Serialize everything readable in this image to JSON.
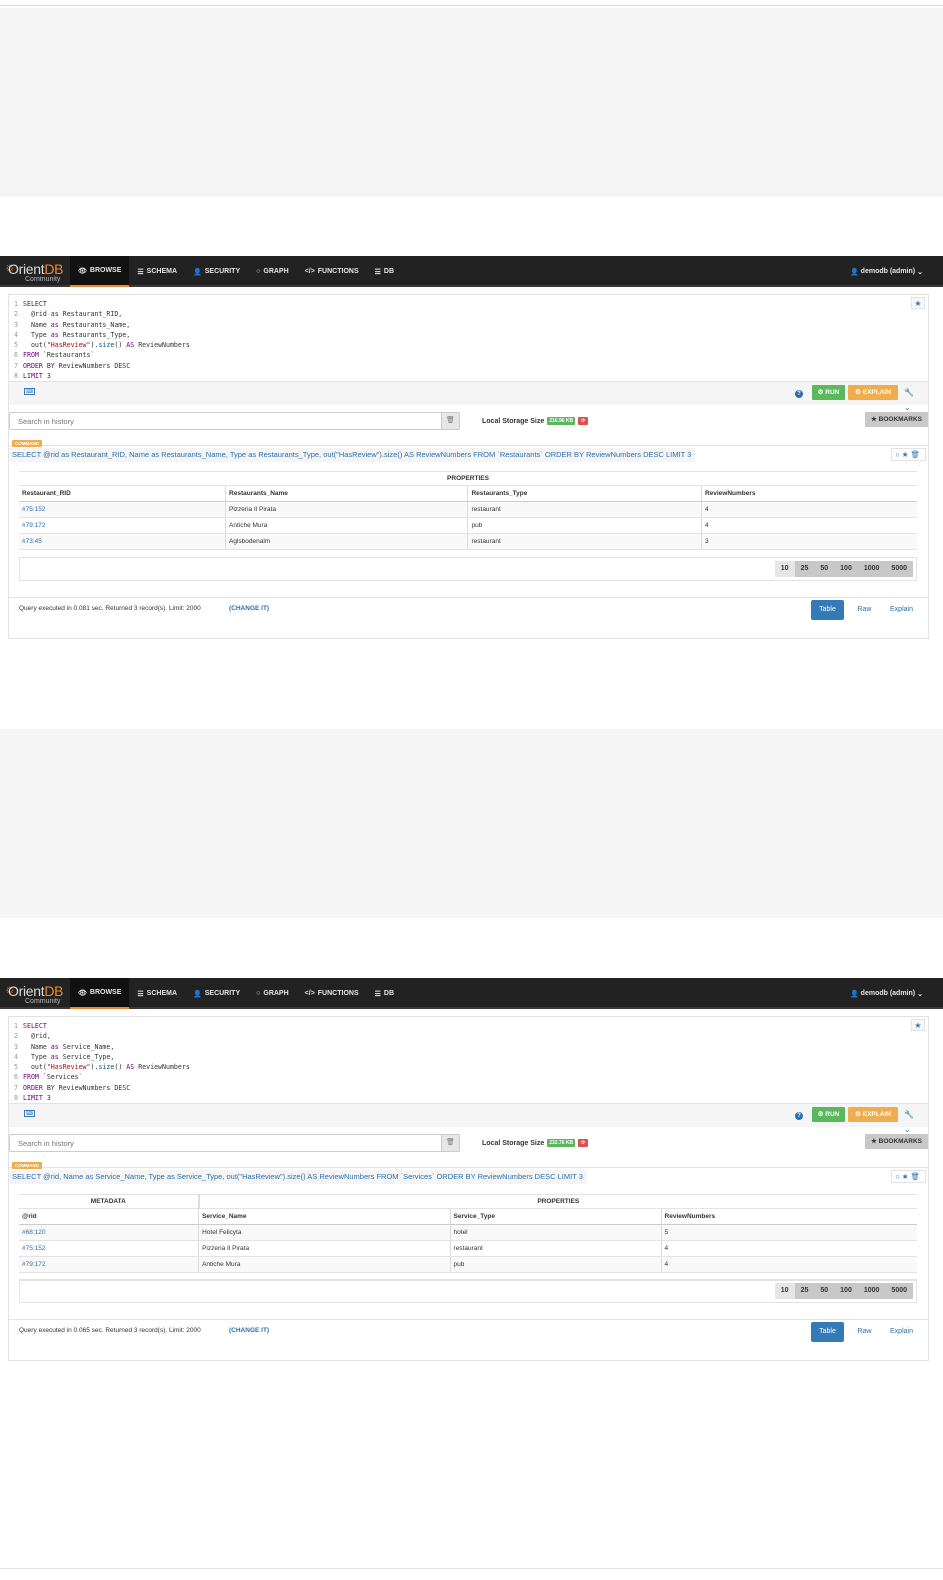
{
  "nav": {
    "brand_orient": "Orient",
    "brand_db": "DB",
    "brand_community": "Community",
    "items": [
      {
        "label": "BROWSE",
        "icon": "eye-icon",
        "glyph": "👁"
      },
      {
        "label": "SCHEMA",
        "icon": "list-icon",
        "glyph": "☰"
      },
      {
        "label": "SECURITY",
        "icon": "user-icon",
        "glyph": "👤"
      },
      {
        "label": "GRAPH",
        "icon": "circle-icon",
        "glyph": "○"
      },
      {
        "label": "FUNCTIONS",
        "icon": "code-icon",
        "glyph": "</>"
      },
      {
        "label": "DB",
        "icon": "database-icon",
        "glyph": "☰"
      }
    ],
    "user": "demodb (admin)"
  },
  "common": {
    "run_label": "RUN",
    "explain_label": "EXPLAIN",
    "search_placeholder": "Search in history",
    "storage_label": "Local Storage Size",
    "bookmarks_label": "BOOKMARKS",
    "badge": "COMMAND",
    "change_label": "(CHANGE IT)",
    "page_sizes": [
      "10",
      "25",
      "50",
      "100",
      "1000",
      "5000"
    ],
    "view_tabs": [
      "Table",
      "Raw",
      "Explain"
    ],
    "group_properties": "PROPERTIES",
    "group_metadata": "METADATA"
  },
  "screens": [
    {
      "code_lines": [
        "SELECT",
        "  @rid as Restaurant_RID,",
        "  Name as Restaurants_Name,",
        "  Type as Restaurants_Type,",
        "  out(\"HasReview\").size() AS ReviewNumbers",
        "FROM `Restaurants`",
        "ORDER BY ReviewNumbers DESC",
        "LIMIT 3"
      ],
      "storage_size": "216.96 KB",
      "query": "SELECT @rid as Restaurant_RID, Name as Restaurants_Name, Type as Restaurants_Type, out(\"HasReview\").size() AS ReviewNumbers FROM `Restaurants` ORDER BY ReviewNumbers DESC LIMIT 3",
      "columns": [
        "Restaurant_RID",
        "Restaurants_Name",
        "Restaurants_Type",
        "ReviewNumbers"
      ],
      "rows": [
        [
          "#75:152",
          "Pizzeria Il Pirata",
          "restaurant",
          "4"
        ],
        [
          "#79:172",
          "Antiche Mura",
          "pub",
          "4"
        ],
        [
          "#73:45",
          "Aglsbodenalm",
          "restaurant",
          "3"
        ]
      ],
      "status": "Query executed in 0.081 sec. Returned 3 record(s). Limit: 2000"
    },
    {
      "code_lines": [
        "SELECT",
        "  @rid,",
        "  Name as Service_Name,",
        "  Type as Service_Type,",
        "  out(\"HasReview\").size() AS ReviewNumbers",
        "FROM `Services`",
        "ORDER BY ReviewNumbers DESC",
        "LIMIT 3"
      ],
      "storage_size": "232.76 KB",
      "query": "SELECT @rid, Name as Service_Name, Type as Service_Type, out(\"HasReview\").size() AS ReviewNumbers FROM `Services` ORDER BY ReviewNumbers DESC LIMIT 3",
      "columns": [
        "@rid",
        "Service_Name",
        "Service_Type",
        "ReviewNumbers"
      ],
      "rows": [
        [
          "#68:120",
          "Hotel Felicyta",
          "hotel",
          "5"
        ],
        [
          "#75:152",
          "Pizzeria Il Pirata",
          "restaurant",
          "4"
        ],
        [
          "#79:172",
          "Antiche Mura",
          "pub",
          "4"
        ]
      ],
      "status": "Query executed in 0.065 sec. Returned 3 record(s). Limit: 2000"
    }
  ],
  "colors": {
    "navbar": "#222222",
    "accent": "#f0892d",
    "run": "#5cb85c",
    "explain": "#f0ad4e",
    "link": "#2a6fb0",
    "active_tab": "#337ab7"
  }
}
